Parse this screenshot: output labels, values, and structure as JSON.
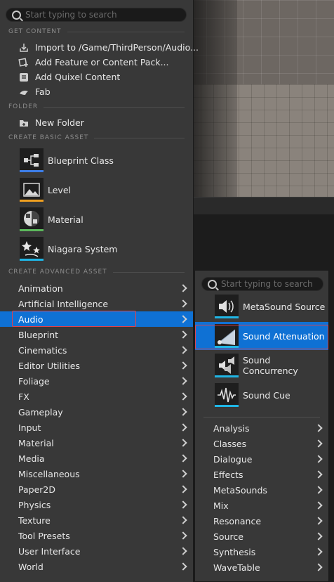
{
  "search": {
    "placeholder": "Start typing to search"
  },
  "sections": {
    "get_content": "GET CONTENT",
    "folder": "FOLDER",
    "create_basic": "CREATE BASIC ASSET",
    "create_advanced": "CREATE ADVANCED ASSET"
  },
  "get_content": [
    {
      "label": "Import to /Game/ThirdPerson/Audio...",
      "icon": "import-icon"
    },
    {
      "label": "Add Feature or Content Pack...",
      "icon": "content-pack-icon"
    },
    {
      "label": "Add Quixel Content",
      "icon": "quixel-icon"
    },
    {
      "label": "Fab",
      "icon": "fab-icon"
    }
  ],
  "folder": [
    {
      "label": "New Folder",
      "icon": "new-folder-icon"
    }
  ],
  "basic_assets": [
    {
      "label": "Blueprint Class",
      "icon": "blueprint-class-icon",
      "color": "#3d7ee8"
    },
    {
      "label": "Level",
      "icon": "level-icon",
      "color": "#f0a020"
    },
    {
      "label": "Material",
      "icon": "material-icon",
      "color": "#5cb85c"
    },
    {
      "label": "Niagara System",
      "icon": "niagara-system-icon",
      "color": "#1fb6e6"
    }
  ],
  "advanced_categories": [
    "Animation",
    "Artificial Intelligence",
    "Audio",
    "Blueprint",
    "Cinematics",
    "Editor Utilities",
    "Foliage",
    "FX",
    "Gameplay",
    "Input",
    "Material",
    "Media",
    "Miscellaneous",
    "Paper2D",
    "Physics",
    "Texture",
    "Tool Presets",
    "User Interface",
    "World"
  ],
  "active_category": "Audio",
  "submenu": {
    "search_placeholder": "Start typing to search",
    "assets": [
      {
        "label": "MetaSound Source",
        "icon": "metasound-source-icon",
        "color": "#1fb6e6"
      },
      {
        "label": "Sound Attenuation",
        "icon": "sound-attenuation-icon",
        "color": "#1fb6e6"
      },
      {
        "label": "Sound Concurrency",
        "icon": "sound-concurrency-icon",
        "color": "#1fb6e6"
      },
      {
        "label": "Sound Cue",
        "icon": "sound-cue-icon",
        "color": "#1fb6e6"
      }
    ],
    "active_asset": "Sound Attenuation",
    "categories": [
      "Analysis",
      "Classes",
      "Dialogue",
      "Effects",
      "MetaSounds",
      "Mix",
      "Resonance",
      "Source",
      "Synthesis",
      "WaveTable"
    ]
  },
  "colors": {
    "menu_bg": "#383838",
    "active_blue": "#0f71d4",
    "highlight_red": "#e0424c"
  }
}
